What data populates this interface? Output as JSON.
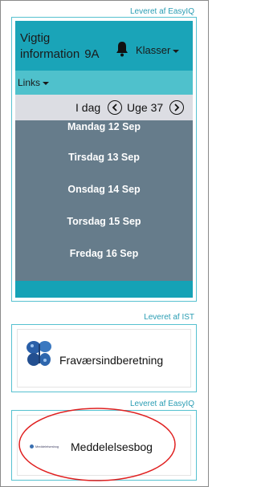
{
  "widget1": {
    "provider": "Leveret af EasyIQ",
    "title_line1": "Vigtig",
    "title_line2": "information",
    "class_name": "9A",
    "bell_icon": "bell-icon",
    "klasser_label": "Klasser",
    "links_label": "Links",
    "today_label": "I dag",
    "week_label": "Uge 37",
    "days": [
      "Mandag 12 Sep",
      "Tirsdag 13 Sep",
      "Onsdag 14 Sep",
      "Torsdag 15 Sep",
      "Fredag 16 Sep"
    ]
  },
  "widget2": {
    "provider": "Leveret af IST",
    "label": "Fraværsindberetning",
    "icon": "butterfly-icon"
  },
  "widget3": {
    "provider": "Leveret af EasyIQ",
    "label": "Meddelelsesbog",
    "logo_text": "Meddelelsesbog"
  },
  "colors": {
    "header": "#1aa4b8",
    "links_bar": "#4fc1cc",
    "week_bar": "#dcdde3",
    "days_bg": "#667c8b",
    "provider_text": "#2a9db3",
    "highlight_ellipse": "#e02020"
  }
}
